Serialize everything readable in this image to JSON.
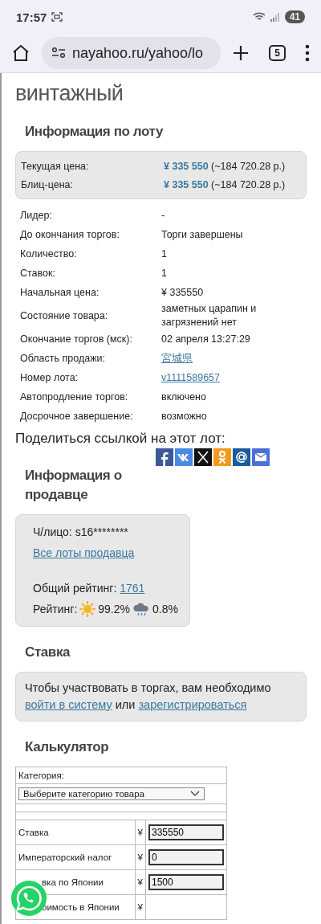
{
  "status_bar": {
    "time": "17:57",
    "battery": "41"
  },
  "browser": {
    "url": "nayahoo.ru/yahoo/lo",
    "tab_count": "5"
  },
  "page_title": "винтажный",
  "lot_info": {
    "heading": "Информация по лоту",
    "prices": [
      {
        "label": "Текущая цена:",
        "price": "¥ 335 550",
        "converted": "(~184 720.28 р.)"
      },
      {
        "label": "Блиц-цена:",
        "price": "¥ 335 550",
        "converted": "(~184 720.28 р.)"
      }
    ],
    "rows": [
      {
        "label": "Лидер:",
        "value": "-",
        "kind": "text"
      },
      {
        "label": "До окончания торгов:",
        "value": "Торги завершены",
        "kind": "text"
      },
      {
        "label": "Количество:",
        "value": "1",
        "kind": "text"
      },
      {
        "label": "Ставок:",
        "value": "1",
        "kind": "text"
      },
      {
        "label": "Начальная цена:",
        "value": "¥ 335550",
        "kind": "text"
      },
      {
        "label": "Состояние товара:",
        "value": "заметных царапин и загрязнений нет",
        "kind": "text"
      },
      {
        "label": "Окончание торгов (мск):",
        "value": "02 апреля 13:27:29",
        "kind": "text"
      },
      {
        "label": "Область продажи:",
        "value": "宮城県",
        "kind": "link"
      },
      {
        "label": "Номер лота:",
        "value": "v1111589657",
        "kind": "link"
      },
      {
        "label": "Автопродление торгов:",
        "value": "включено",
        "kind": "text"
      },
      {
        "label": "Досрочное завершение:",
        "value": "возможно",
        "kind": "text"
      }
    ]
  },
  "share": {
    "label": "Поделиться ссылкой на этот лот:",
    "buttons": [
      {
        "kind": "facebook"
      },
      {
        "kind": "vk"
      },
      {
        "kind": "x"
      },
      {
        "kind": "ok"
      },
      {
        "kind": "at"
      },
      {
        "kind": "mail"
      }
    ]
  },
  "seller": {
    "heading": "Информация о продавце",
    "person": "Ч/лицо: s16********",
    "all_lots": "Все лоты продавца",
    "total_label": "Общий рейтинг:",
    "total": "1761",
    "rating_label": "Рейтинг:",
    "positive": "99.2%",
    "negative": "0.8%"
  },
  "bid": {
    "heading": "Ставка",
    "text": "Чтобы участвовать в торгах, вам необходимо",
    "login": "войти в систему",
    "or": "или",
    "register": "зарегистрироваться"
  },
  "calculator": {
    "heading": "Калькулятор",
    "category_label": "Категория:",
    "category_select": "Выберите категорию товара",
    "rows": [
      {
        "label": "Ставка",
        "currency": "¥",
        "value": "335550",
        "covered": false
      },
      {
        "label": "Императорский налог",
        "currency": "¥",
        "value": "0",
        "covered": false
      },
      {
        "label": "вка по Японии",
        "currency": "¥",
        "value": "1500",
        "covered": true
      },
      {
        "label": "оимость в Японии",
        "currency": "¥",
        "covered": true
      }
    ]
  }
}
